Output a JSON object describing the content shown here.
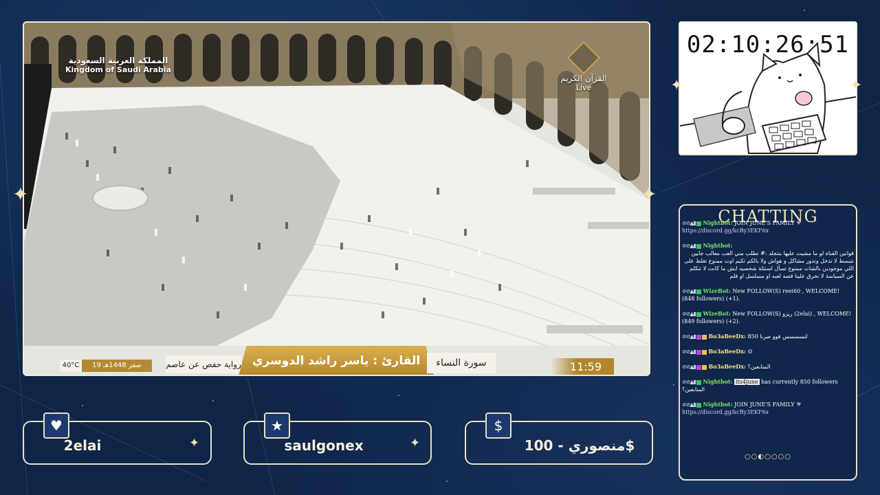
{
  "video": {
    "ksa_logo_ar": "المملكة العربية السعودية",
    "ksa_logo_en": "Kingdom of Saudi Arabia",
    "channel_logo_ar": "القرآن الكريم",
    "channel_live": "Live",
    "temperature": "40°C",
    "date": "19 صفر 1448هـ",
    "riwaya": "رواية حفص عن عاصم",
    "qari": "القارئ : ياسر راشد الدوسري",
    "surah": "سورة النساء",
    "time": "11:59"
  },
  "timer": {
    "value": "02:10:26:51"
  },
  "chat": {
    "title": "CHATTING",
    "messages": [
      {
        "user": "Nightbot:",
        "user_color": "green",
        "text": "JOIN JUNE'S FAMILY",
        "link": "https://discord.gg/kcBy3EKF6x"
      },
      {
        "user": "Nightbot:",
        "user_color": "green",
        "text": "قوانين القناة لو ما مشيت عليها بتنجلد :# تطلب مني العب معالب جايين نتبسط لا تدخل وتدور مشاكل و هواش ولا بالكم تكيم اوت ممنوع تغلط على اللي موجودين بالشات ممنوع تسأل استئلة شخصيه ايش ما كانت لا تتكلم عن السياسة لا تحرق علينا قصه لعبه او مسلسل او فلم"
      },
      {
        "user": "WizeBot:",
        "user_color": "green",
        "text": "New FOLLOW(S) reei60 , WELCOME! (848 followers) (+1)."
      },
      {
        "user": "WizeBot:",
        "user_color": "green",
        "text": "New FOLLOW(S) ريزو (2elai) , WELCOME! (849 followers) (+2)."
      },
      {
        "user": "Bo3aBeeDx:",
        "user_color": "yellow",
        "text": "لتسسسس فوو صرنا 850"
      },
      {
        "user": "Bo3aBeeDx:",
        "user_color": "yellow",
        "text": ""
      },
      {
        "user": "Bo3aBeeDx:",
        "user_color": "yellow",
        "text": "المتابعين؟"
      },
      {
        "user": "Nightbot:",
        "user_color": "green",
        "mention": "its4june",
        "text": "has currently 850 followers",
        "prefix_ar": "المتابعين؟"
      },
      {
        "user": "Nightbot:",
        "user_color": "green",
        "text": "JOIN JUNE'S FAMILY",
        "link": "https://discord.gg/kcBy3EKF6x"
      }
    ],
    "page_dots": "○○◐○○○○"
  },
  "events": {
    "follower": {
      "icon": "heart-icon",
      "label": "2elai"
    },
    "subscriber": {
      "icon": "star-icon",
      "label": "saulgonex"
    },
    "donation": {
      "icon": "dollar-icon",
      "glyph": "$",
      "label": "منصوري - 100$"
    }
  },
  "colors": {
    "background": "#0f2547",
    "frame": "#f3ecd6",
    "gold": "#b3862c",
    "chat_title": "#f1e3b4"
  }
}
